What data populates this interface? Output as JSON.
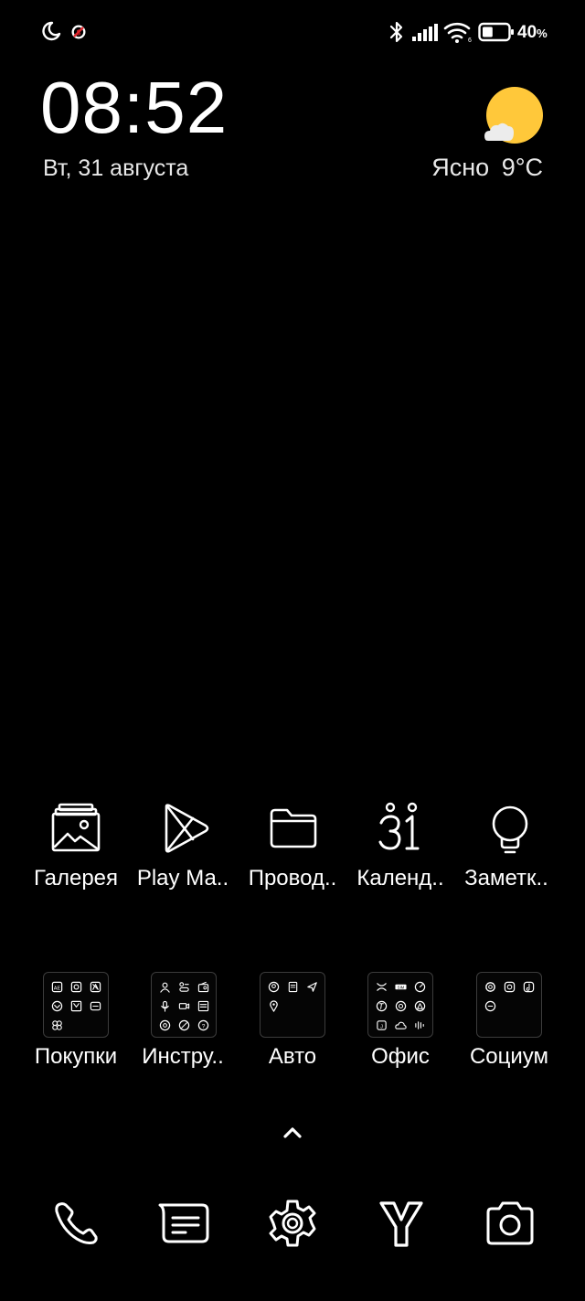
{
  "status_bar": {
    "icons_left": [
      "moon-icon",
      "do-not-disturb-icon"
    ],
    "icons_right": [
      "bluetooth-icon",
      "signal-icon",
      "wifi-icon",
      "battery-icon"
    ],
    "battery_percent": "40",
    "battery_unit": "%",
    "battery_level": 0.4
  },
  "clock_widget": {
    "time": "08:52",
    "date": "Вт, 31 августа"
  },
  "weather_widget": {
    "condition": "Ясно",
    "temperature": "9°C",
    "icon": "sun-with-cloud-icon",
    "sun_color": "#FFC83A"
  },
  "apps": [
    {
      "label": "Галерея",
      "icon": "gallery-icon"
    },
    {
      "label": "Play Ма..",
      "icon": "play-market-icon"
    },
    {
      "label": "Провод..",
      "icon": "folder-icon"
    },
    {
      "label": "Календ..",
      "icon": "calendar-icon"
    },
    {
      "label": "Заметк..",
      "icon": "notes-bulb-icon"
    }
  ],
  "folders": [
    {
      "label": "Покупки"
    },
    {
      "label": "Инстру.."
    },
    {
      "label": "Авто"
    },
    {
      "label": "Офис"
    },
    {
      "label": "Социум"
    }
  ],
  "app_drawer_indicator": "chevron-up-icon",
  "dock": [
    "phone-icon",
    "messages-icon",
    "settings-icon",
    "yandex-browser-icon",
    "camera-icon"
  ]
}
